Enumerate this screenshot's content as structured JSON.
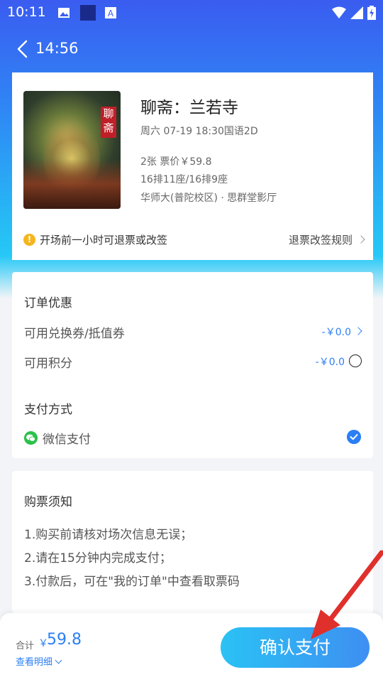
{
  "status_bar": {
    "time": "10:11",
    "icons": [
      "image-icon",
      "square-icon",
      "font-icon",
      "wifi-icon",
      "signal-icon",
      "battery-charging-icon"
    ]
  },
  "header": {
    "title": "14:56"
  },
  "movie": {
    "title": "聊斋：兰若寺",
    "showtime": "周六 07-19 18:30国语2D",
    "tickets": "2张 票价￥59.8",
    "seats": "16排11座/16排9座",
    "cinema": "华师大(普陀校区) · 思群堂影厅",
    "poster_text": "聊斋"
  },
  "refund": {
    "notice": "开场前一小时可退票或改签",
    "rules_link": "退票改签规则"
  },
  "discount": {
    "section_title": "订单优惠",
    "voucher_label": "可用兑换券/抵值券",
    "voucher_value": "-￥0.0",
    "points_label": "可用积分",
    "points_value": "-￥0.0",
    "payment_title": "支付方式",
    "wechat_label": "微信支付"
  },
  "notice": {
    "title": "购票须知",
    "lines": [
      "1.购买前请核对场次信息无误；",
      "2.请在15分钟内完成支付；",
      "3.付款后，可在\"我的订单\"中查看取票码"
    ]
  },
  "bottom": {
    "total_label": "合计",
    "currency": "￥",
    "total_amount": "59.8",
    "detail_link": "查看明细",
    "pay_button": "确认支付"
  },
  "colors": {
    "accent": "#2b7ff5",
    "header_gradient_top": "#3a5cf0",
    "header_gradient_bottom": "#26c8f7",
    "warning": "#f6b51d",
    "wechat_green": "#2bc14b",
    "annotation_red": "#e0302c"
  }
}
